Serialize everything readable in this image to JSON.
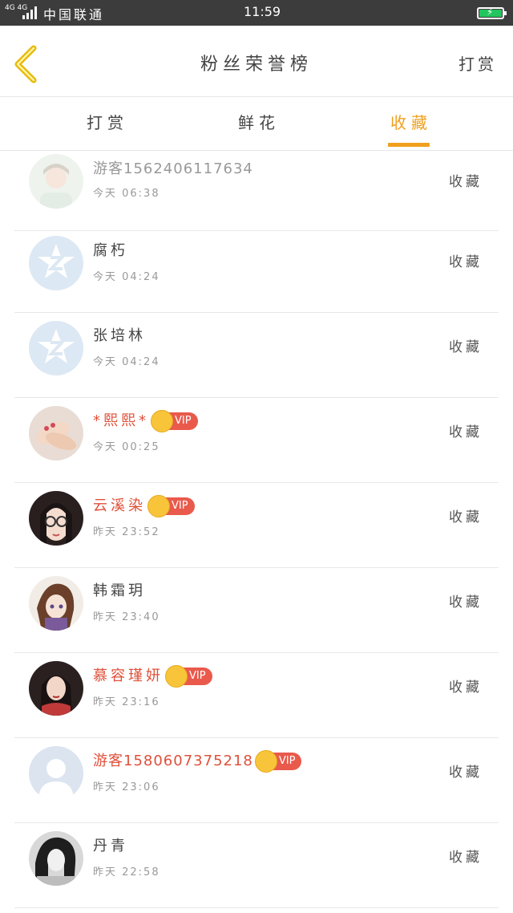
{
  "status_bar": {
    "network": "4G 4G",
    "carrier": "中国联通",
    "time": "11:59"
  },
  "header": {
    "title": "粉丝荣誉榜",
    "action": "打赏"
  },
  "tabs": [
    {
      "label": "打赏",
      "active": false
    },
    {
      "label": "鲜花",
      "active": false
    },
    {
      "label": "收藏",
      "active": true
    }
  ],
  "accent_color": "#f0a01e",
  "vip_color": "#e0503a",
  "vip_label": "VIP",
  "list": [
    {
      "name": "游客15624061176​34",
      "time": "今天 06:38",
      "action": "收藏",
      "vip": false,
      "avatar": "girl-photo-avatar"
    },
    {
      "name": "腐朽",
      "time": "今天 04:24",
      "action": "收藏",
      "vip": false,
      "avatar": "default-z-avatar"
    },
    {
      "name": "张培林",
      "time": "今天 04:24",
      "action": "收藏",
      "vip": false,
      "avatar": "default-z-avatar"
    },
    {
      "name": "*熙熙*",
      "time": "今天 00:25",
      "action": "收藏",
      "vip": true,
      "avatar": "hands-photo-avatar"
    },
    {
      "name": "云溪染",
      "time": "昨天 23:52",
      "action": "收藏",
      "vip": true,
      "avatar": "glasses-girl-avatar"
    },
    {
      "name": "韩霜玥",
      "time": "昨天 23:40",
      "action": "收藏",
      "vip": false,
      "avatar": "anime-girl-avatar"
    },
    {
      "name": "慕容瑾妍",
      "time": "昨天 23:16",
      "action": "收藏",
      "vip": true,
      "avatar": "costume-girl-avatar"
    },
    {
      "name": "游客15806073752​18",
      "time": "昨天 23:06",
      "action": "收藏",
      "vip": true,
      "avatar": "default-person-avatar"
    },
    {
      "name": "丹青",
      "time": "昨天 22:58",
      "action": "收藏",
      "vip": false,
      "avatar": "bw-girl-avatar"
    }
  ]
}
